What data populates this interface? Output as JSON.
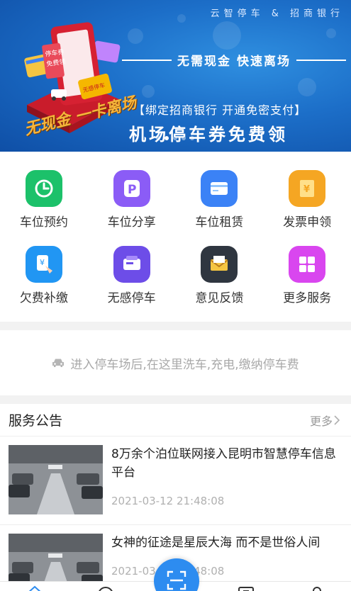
{
  "banner": {
    "brand": "云智停车 & 招商银行",
    "slogan": "无需现金  快速离场",
    "bind_line": "【绑定招商银行  开通免密支付】",
    "headline": "机场停车券免费领",
    "art_text": "无现金 一卡离场",
    "slide_count": 5,
    "active_slide": 1
  },
  "features": [
    {
      "label": "车位预约",
      "icon": "clock-icon",
      "color": "#1cc16a"
    },
    {
      "label": "车位分享",
      "icon": "parking-share-icon",
      "color": "#8b5cf6"
    },
    {
      "label": "车位租赁",
      "icon": "card-icon",
      "color": "#3b82f6"
    },
    {
      "label": "发票申领",
      "icon": "invoice-icon",
      "color": "#f5a623"
    },
    {
      "label": "欠费补缴",
      "icon": "tap-pay-icon",
      "color": "#2196f3"
    },
    {
      "label": "无感停车",
      "icon": "wallet-icon",
      "color": "#6d4de8"
    },
    {
      "label": "意见反馈",
      "icon": "envelope-icon",
      "color": "#2f3640"
    },
    {
      "label": "更多服务",
      "icon": "grid-icon",
      "color": "#d946ef"
    }
  ],
  "notice": {
    "text": "进入停车场后,在这里洗车,充电,缴纳停车费"
  },
  "announcements": {
    "title": "服务公告",
    "more_label": "更多",
    "items": [
      {
        "title": "8万余个泊位联网接入昆明市智慧停车信息平台",
        "time": "2021-03-12 21:48:08"
      },
      {
        "title": "女神的征途是星辰大海 而不是世俗人间",
        "time": "2021-03-12 21:48:08"
      }
    ]
  },
  "accent": "#2d8cf0"
}
